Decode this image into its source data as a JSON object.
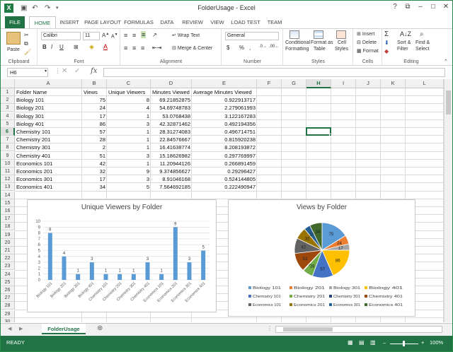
{
  "window": {
    "title": "FolderUsage - Excel",
    "app_icon": "X",
    "controls": [
      "?",
      "⧉",
      "–",
      "□",
      "✕"
    ]
  },
  "ribbon_tabs": [
    "FILE",
    "HOME",
    "INSERT",
    "PAGE LAYOUT",
    "FORMULAS",
    "DATA",
    "REVIEW",
    "VIEW",
    "LOAD TEST",
    "TEAM"
  ],
  "active_tab": "HOME",
  "ribbon": {
    "clipboard": {
      "paste": "Paste",
      "label": "Clipboard"
    },
    "font": {
      "name": "Calibri",
      "size": "11",
      "label": "Font",
      "bold": "B",
      "italic": "I",
      "underline": "U"
    },
    "alignment": {
      "wrap_text": "Wrap Text",
      "merge": "Merge & Center",
      "label": "Alignment"
    },
    "number": {
      "format": "General",
      "currency": "$",
      "percent": "%",
      "comma": ",",
      "label": "Number"
    },
    "styles": {
      "conditional": "Conditional",
      "conditional2": "Formatting",
      "format_as": "Format as",
      "format_as2": "Table",
      "cell": "Cell",
      "cell2": "Styles",
      "label": "Styles"
    },
    "cells": {
      "insert": "Insert",
      "delete": "Delete",
      "format": "Format",
      "label": "Cells"
    },
    "editing": {
      "sort": "Sort &",
      "sort2": "Filter",
      "find": "Find &",
      "find2": "Select",
      "label": "Editing",
      "sum": "Σ"
    }
  },
  "formula_bar": {
    "name_box": "H6",
    "fx": "fx",
    "formula": ""
  },
  "columns": [
    "A",
    "B",
    "C",
    "D",
    "E",
    "F",
    "G",
    "H",
    "I",
    "J",
    "K",
    "L"
  ],
  "selected_column": "H",
  "selected_row": "6",
  "rows": [
    "1",
    "2",
    "3",
    "4",
    "5",
    "6",
    "7",
    "8",
    "9",
    "10",
    "11",
    "12",
    "13",
    "14",
    "15",
    "16",
    "17",
    "18",
    "19",
    "20",
    "21",
    "22",
    "23",
    "24",
    "25",
    "26",
    "27",
    "28",
    "29",
    "30"
  ],
  "table": {
    "headers": [
      "Folder Name",
      "Views",
      "Unique Viewers",
      "Minutes Viewed",
      "Average Minutes Viewed"
    ],
    "rows": [
      [
        "Biology 101",
        "75",
        "8",
        "69.21852875",
        "0.922913717"
      ],
      [
        "Biology 201",
        "24",
        "4",
        "54.69748783",
        "2.279061993"
      ],
      [
        "Biology 301",
        "17",
        "1",
        "53.0768438",
        "3.122167283"
      ],
      [
        "Biology 401",
        "86",
        "3",
        "42.32871462",
        "0.492194356"
      ],
      [
        "Chemistry 101",
        "57",
        "1",
        "28.31274083",
        "0.496714751"
      ],
      [
        "Chemistry 201",
        "28",
        "1",
        "22.84576667",
        "0.815920238"
      ],
      [
        "Chemistry 301",
        "2",
        "1",
        "16.41638774",
        "8.208193872"
      ],
      [
        "Chemistry 401",
        "51",
        "3",
        "15.18626982",
        "0.297769997"
      ],
      [
        "Economics 101",
        "42",
        "1",
        "11.20944126",
        "0.266891459"
      ],
      [
        "Economics 201",
        "32",
        "9",
        "9.374856627",
        "0.29296427"
      ],
      [
        "Economics 301",
        "17",
        "3",
        "8.91046168",
        "0.524144805"
      ],
      [
        "Economics 401",
        "34",
        "5",
        "7.564692185",
        "0.222490947"
      ]
    ]
  },
  "chart_data": [
    {
      "type": "bar",
      "title": "Unique Viewers by Folder",
      "categories": [
        "Biology 101",
        "Biology 201",
        "Biology 301",
        "Biology 401",
        "Chemistry 101",
        "Chemistry 201",
        "Chemistry 301",
        "Chemistry 401",
        "Economics 101",
        "Economics 201",
        "Economics 301",
        "Economics 401"
      ],
      "values": [
        8,
        4,
        1,
        3,
        1,
        1,
        1,
        3,
        1,
        9,
        3,
        5
      ],
      "ylim": [
        0,
        10
      ],
      "yticks": [
        "0",
        "1",
        "2",
        "3",
        "4",
        "5",
        "6",
        "7",
        "8",
        "9",
        "10"
      ],
      "color": "#5b9bd5",
      "grid": true
    },
    {
      "type": "pie",
      "title": "Views by Folder",
      "categories": [
        "Biology 101",
        "Biology 201",
        "Biology 301",
        "Biology 401",
        "Chemistry 101",
        "Chemistry 201",
        "Chemistry 301",
        "Chemistry 401",
        "Economics 101",
        "Economics 201",
        "Economics 301",
        "Economics 401"
      ],
      "values": [
        75,
        24,
        17,
        86,
        57,
        28,
        2,
        51,
        42,
        32,
        17,
        34
      ],
      "colors": [
        "#5b9bd5",
        "#ed7d31",
        "#a5a5a5",
        "#ffc000",
        "#4472c4",
        "#70ad47",
        "#264478",
        "#9e480e",
        "#636363",
        "#997300",
        "#255e91",
        "#43682b"
      ],
      "legend": "bottom"
    }
  ],
  "sheet_tabs": [
    "FolderUsage"
  ],
  "add_sheet": "⊕",
  "status": {
    "ready": "READY",
    "zoom": "100%",
    "zoom_minus": "–",
    "zoom_plus": "+"
  }
}
